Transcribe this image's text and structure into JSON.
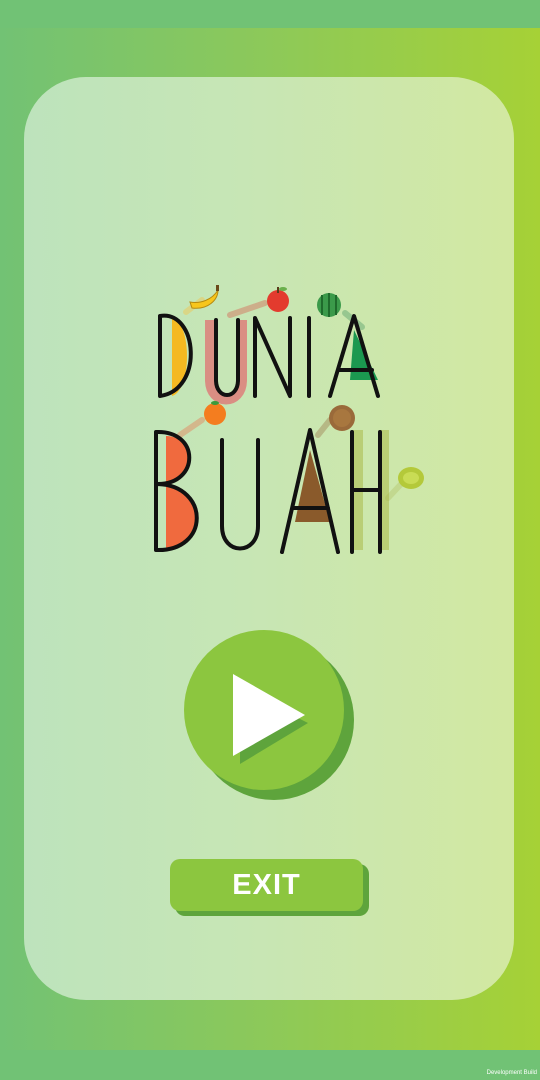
{
  "logo": {
    "line1": "DUNIA",
    "line2": "BUAH"
  },
  "buttons": {
    "exit_label": "EXIT"
  },
  "footer": {
    "build_label": "Development Build"
  },
  "icons": {
    "play": "play-icon",
    "fruits": [
      "banana-icon",
      "apple-icon",
      "watermelon-icon",
      "orange-icon",
      "kiwi-icon",
      "lime-icon"
    ]
  },
  "colors": {
    "background": "#71c275",
    "panel": "#c7e6b5",
    "button": "#8cc63f",
    "button_shadow": "#5ea43c"
  }
}
